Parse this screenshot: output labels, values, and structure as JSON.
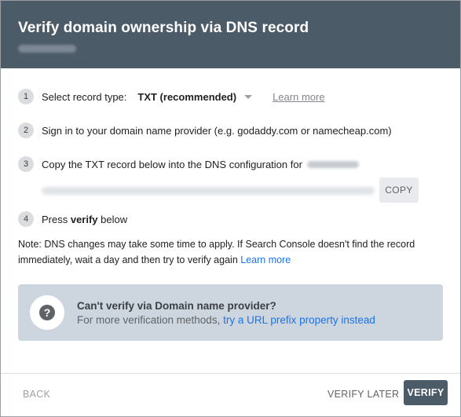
{
  "header": {
    "title": "Verify domain ownership via DNS record"
  },
  "steps": {
    "step1": {
      "number": "1",
      "label": "Select record type:",
      "record_type": "TXT (recommended)",
      "learn_more": "Learn more"
    },
    "step2": {
      "number": "2",
      "text": "Sign in to your domain name provider (e.g. godaddy.com or namecheap.com)"
    },
    "step3": {
      "number": "3",
      "text": "Copy the TXT record below into the DNS configuration for",
      "copy_label": "COPY"
    },
    "step4": {
      "number": "4",
      "prefix": "Press ",
      "bold": "verify",
      "suffix": " below"
    }
  },
  "note": {
    "text": "Note: DNS changes may take some time to apply. If Search Console doesn't find the record immediately, wait a day and then try to verify again ",
    "link": "Learn more"
  },
  "info": {
    "icon": "help-icon",
    "title": "Can't verify via Domain name provider?",
    "desc": "For more verification methods, ",
    "link": "try a URL prefix property instead"
  },
  "footer": {
    "back": "BACK",
    "verify_later": "VERIFY LATER",
    "verify": "VERIFY"
  },
  "colors": {
    "header_bg": "#4c5b68",
    "link": "#1a73e8",
    "info_bg": "#cdd6df"
  }
}
